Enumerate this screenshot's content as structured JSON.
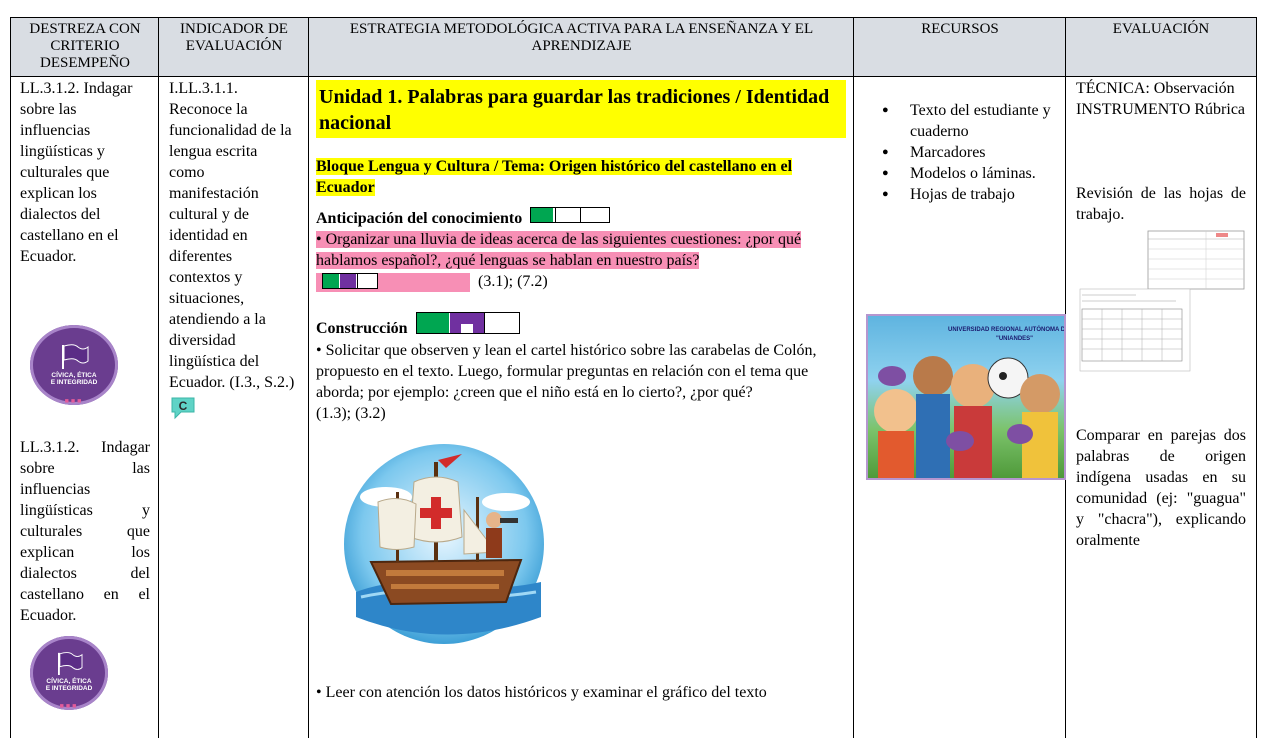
{
  "headers": {
    "col1": "DESTREZA CON CRITERIO DESEMPEÑO",
    "col2": "INDICADOR DE EVALUACIÓN",
    "col3": "ESTRATEGIA METODOLÓGICA ACTIVA PARA LA ENSEÑANZA Y EL APRENDIZAJE",
    "col4": "RECURSOS",
    "col5": "EVALUACIÓN"
  },
  "col1": {
    "text1": "LL.3.1.2. Indagar sobre las influencias lingüísticas y culturales que explican los dialectos del castellano en el Ecuador.",
    "text2": "LL.3.1.2. Indagar sobre las influencias lingüísticas y culturales que explican los dialectos del castellano en el Ecuador.",
    "badge_line1": "CÍVICA, ÉTICA",
    "badge_line2": "E INTEGRIDAD"
  },
  "col2": {
    "text": "I.LL.3.1.1. Reconoce la funcionalidad de la lengua escrita como manifestación cultural y de identidad en diferentes contextos y situaciones, atendiendo a la diversidad lingüística del Ecuador. (I.3., S.2.)",
    "icon_letter": "C"
  },
  "col3": {
    "unit_title": "Unidad 1. Palabras para guardar las tradiciones / Identidad nacional",
    "block_title": "Bloque Lengua y Cultura / Tema: Origen histórico del castellano en el Ecuador",
    "anticipation_heading": "Anticipación del conocimiento",
    "anticipation_text": "• Organizar una lluvia de ideas acerca de las siguientes cuestiones: ¿por qué hablamos español?, ¿qué lenguas se hablan en nuestro país?",
    "anticipation_refs": "(3.1); (7.2)",
    "construction_heading": "Construcción",
    "construction_text": "• Solicitar que observen y lean el cartel histórico sobre las carabelas de Colón, propuesto en el texto. Luego, formular preguntas en relación con el tema que aborda; por ejemplo: ¿creen que el niño está en lo cierto?, ¿por qué?",
    "construction_refs": "(1.3); (3.2)",
    "cut_text": "• Leer con atención los datos históricos y examinar el gráfico del texto"
  },
  "col4": {
    "resources": [
      "Texto del estudiante y cuaderno",
      "Marcadores",
      "Modelos o láminas.",
      "Hojas de trabajo"
    ],
    "poster_title": "UNIVERSIDAD REGIONAL AUTÓNOMA DE LOS ANDES",
    "poster_subtitle": "\"UNIANDES\""
  },
  "col5": {
    "technique": "TÉCNICA: Observación",
    "instrument": "INSTRUMENTO Rúbrica",
    "review": "Revisión de las hojas de trabajo.",
    "compare": "Comparar en parejas dos palabras de origen indígena usadas en su comunidad (ej: \"guagua\" y \"chacra\"), explicando oralmente"
  },
  "colors": {
    "header_bg": "#d9dde3",
    "highlight_yellow": "#ffff00",
    "highlight_pink": "#f78fb5",
    "badge": "#6a3d8f",
    "bar_green": "#00a651",
    "bar_purple": "#7030a0"
  }
}
